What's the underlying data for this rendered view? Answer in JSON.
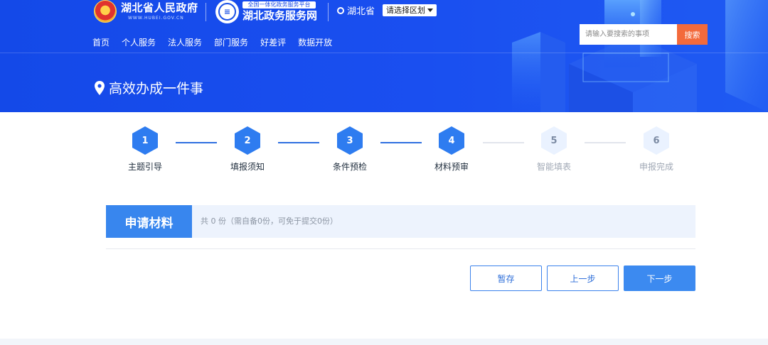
{
  "header": {
    "gov_name": "湖北省人民政府",
    "gov_url": "WWW.HUBEI.GOV.CN",
    "platform_tag": "全国一体化政务服务平台",
    "platform_name": "湖北政务服务网",
    "province": "湖北省",
    "region_select": "请选择区划",
    "nav": [
      "首页",
      "个人服务",
      "法人服务",
      "部门服务",
      "好差评",
      "数据开放"
    ],
    "search": {
      "placeholder": "请输入要搜索的事项",
      "button": "搜索"
    },
    "page_title": "高效办成一件事"
  },
  "steps": [
    {
      "num": "1",
      "label": "主题引导",
      "state": "active"
    },
    {
      "num": "2",
      "label": "填报须知",
      "state": "active"
    },
    {
      "num": "3",
      "label": "条件预检",
      "state": "active"
    },
    {
      "num": "4",
      "label": "材料预审",
      "state": "active"
    },
    {
      "num": "5",
      "label": "智能填表",
      "state": "inactive"
    },
    {
      "num": "6",
      "label": "申报完成",
      "state": "inactive"
    }
  ],
  "materials": {
    "title": "申请材料",
    "summary": "共 0 份（需自备0份，可免于提交0份）"
  },
  "actions": {
    "save": "暂存",
    "prev": "上一步",
    "next": "下一步"
  },
  "colors": {
    "banner": "#1a4ff0",
    "accent": "#3886ee",
    "search_button": "#f36a3b"
  }
}
